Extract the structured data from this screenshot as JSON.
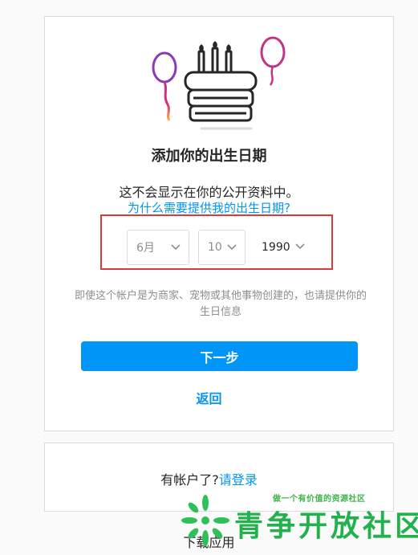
{
  "birthday": {
    "title": "添加你的出生日期",
    "subtitle": "这不会显示在你的公开资料中。",
    "why_link": "为什么需要提供我的出生日期?",
    "month": "6月",
    "day": "10",
    "year": "1990",
    "note": "即使这个帐户是为商家、宠物或其他事物创建的，也请提供你的生日信息",
    "next_button": "下一步",
    "back_link": "返回"
  },
  "login": {
    "prompt": "有帐户了?",
    "link": "请登录"
  },
  "download_app": "下载应用",
  "watermark": {
    "slogan": "做一个有价值的资源社区",
    "name": "青争开放社区"
  },
  "icons": [
    "birthday-cake-icon",
    "balloon-icon",
    "chevron-down-icon"
  ],
  "colors": {
    "accent": "#0095f6",
    "highlight_border": "#d93a3a",
    "watermark_green": "#23b14d"
  }
}
